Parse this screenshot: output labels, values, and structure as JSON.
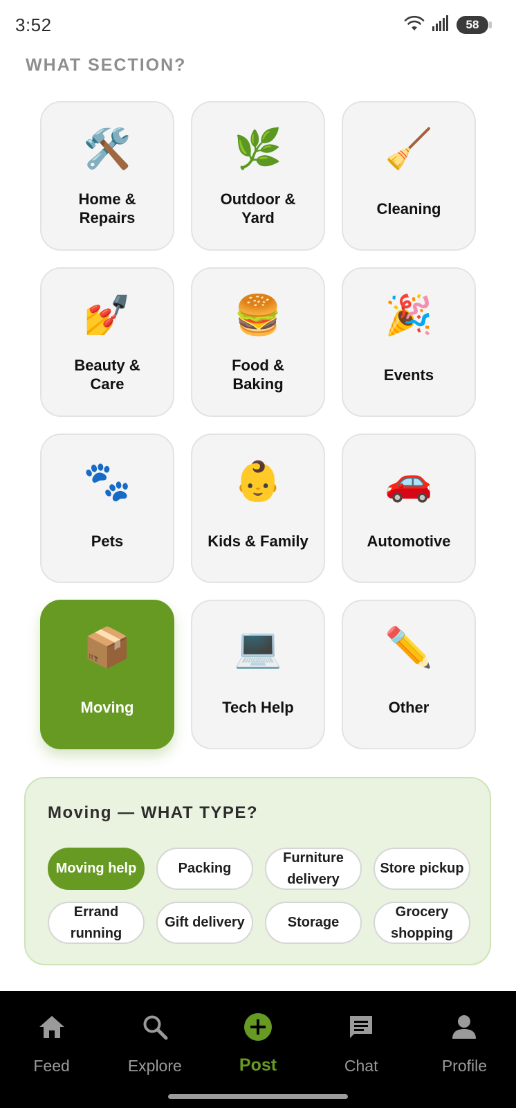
{
  "status_bar": {
    "time": "3:52",
    "battery": "58"
  },
  "section_heading": "WHAT SECTION?",
  "categories": [
    {
      "label": "Home &\nRepairs",
      "emoji": "🛠️",
      "icon": "hammer-wrench-icon"
    },
    {
      "label": "Outdoor &\nYard",
      "emoji": "🌿",
      "icon": "herb-icon"
    },
    {
      "label": "Cleaning",
      "emoji": "🧹",
      "icon": "broom-icon"
    },
    {
      "label": "Beauty &\nCare",
      "emoji": "💅",
      "icon": "nail-polish-icon"
    },
    {
      "label": "Food &\nBaking",
      "emoji": "🍔",
      "icon": "burger-icon"
    },
    {
      "label": "Events",
      "emoji": "🎉",
      "icon": "party-popper-icon"
    },
    {
      "label": "Pets",
      "emoji": "🐾",
      "icon": "paw-prints-icon"
    },
    {
      "label": "Kids & Family",
      "emoji": "👶",
      "icon": "baby-icon"
    },
    {
      "label": "Automotive",
      "emoji": "🚗",
      "icon": "car-icon"
    },
    {
      "label": "Moving",
      "emoji": "📦",
      "icon": "package-icon",
      "selected": true
    },
    {
      "label": "Tech Help",
      "emoji": "💻",
      "icon": "laptop-icon"
    },
    {
      "label": "Other",
      "emoji": "✏️",
      "icon": "pencil-icon"
    }
  ],
  "type_panel": {
    "title": "Moving — WHAT TYPE?",
    "types": [
      {
        "label": "Moving help",
        "selected": true
      },
      {
        "label": "Packing"
      },
      {
        "label": "Furniture delivery"
      },
      {
        "label": "Store pickup"
      },
      {
        "label": "Errand running"
      },
      {
        "label": "Gift delivery"
      },
      {
        "label": "Storage"
      },
      {
        "label": "Grocery shopping"
      }
    ]
  },
  "nav": {
    "items": [
      {
        "label": "Feed",
        "icon": "home-icon"
      },
      {
        "label": "Explore",
        "icon": "search-icon"
      },
      {
        "label": "Post",
        "icon": "add-circle-icon",
        "active": true
      },
      {
        "label": "Chat",
        "icon": "chat-icon"
      },
      {
        "label": "Profile",
        "icon": "person-icon"
      }
    ]
  },
  "colors": {
    "accent": "#679a23",
    "tile_bg": "#f4f4f4",
    "panel_bg": "#eaf3df"
  }
}
